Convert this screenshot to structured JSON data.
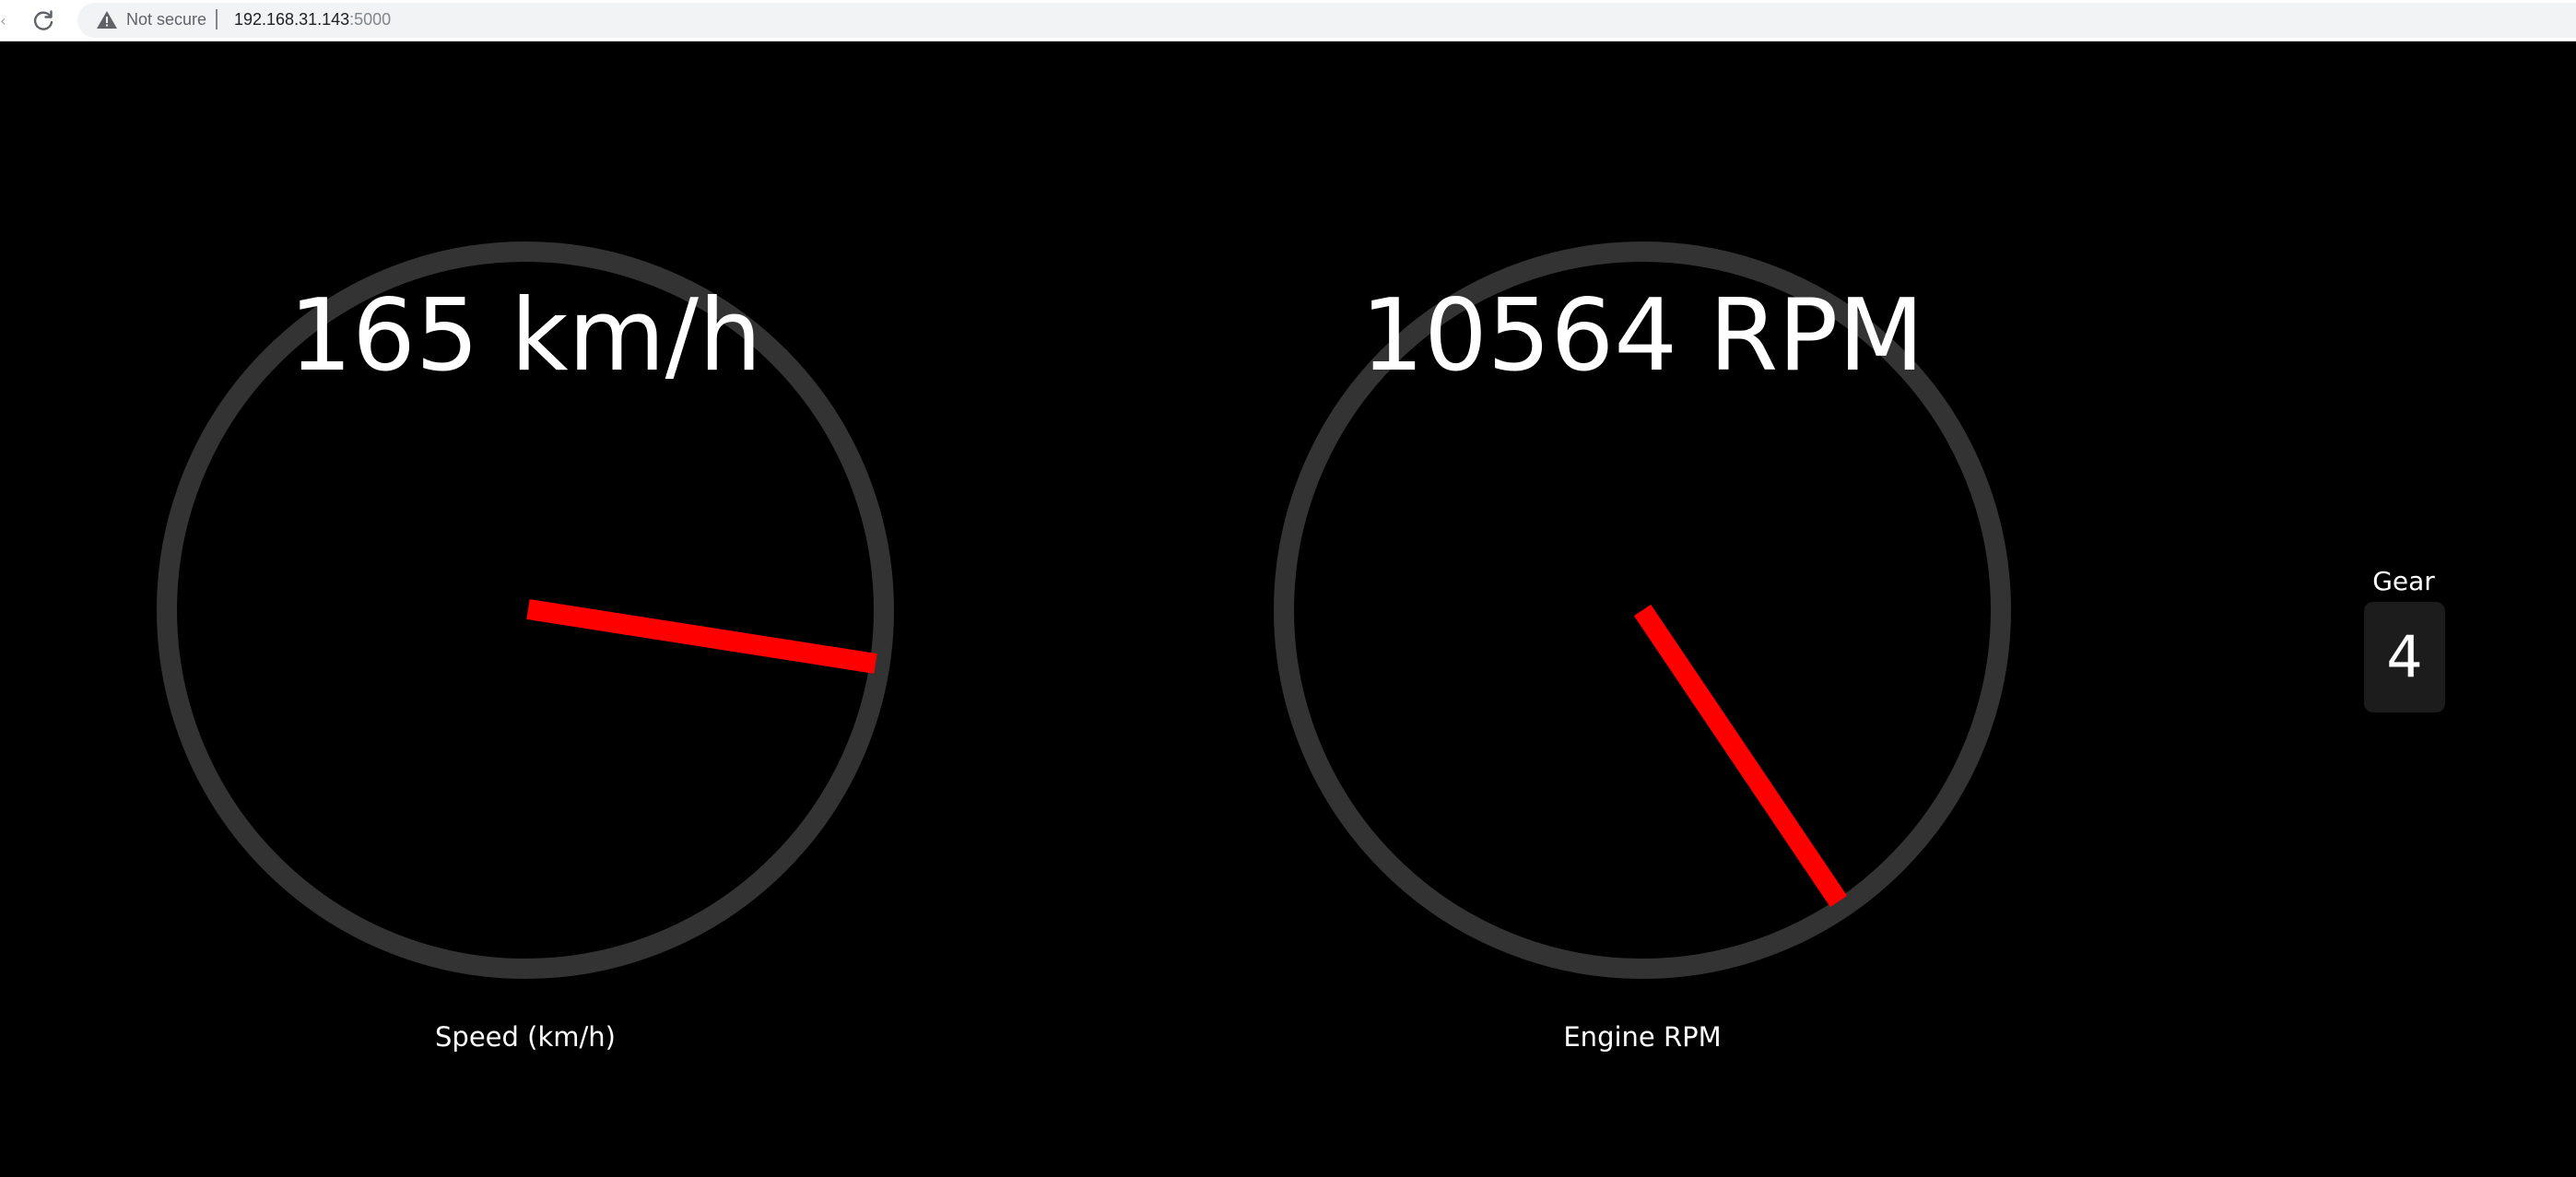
{
  "browser": {
    "security_label": "Not secure",
    "url_host": "192.168.31.143",
    "url_port": ":5000",
    "icons": {
      "reload": "reload-icon",
      "warning": "warning-icon"
    }
  },
  "dashboard": {
    "speed": {
      "value": 165,
      "readout": "165 km/h",
      "label": "Speed (km/h)"
    },
    "rpm": {
      "value": 10564,
      "readout": "10564 RPM",
      "label": "Engine RPM"
    },
    "gear": {
      "title": "Gear",
      "value": "4"
    }
  },
  "colors": {
    "background": "#000000",
    "gauge_ring": "#333333",
    "needle": "#ff0000",
    "text": "#ffffff",
    "gear_box": "#1c1c1c"
  }
}
